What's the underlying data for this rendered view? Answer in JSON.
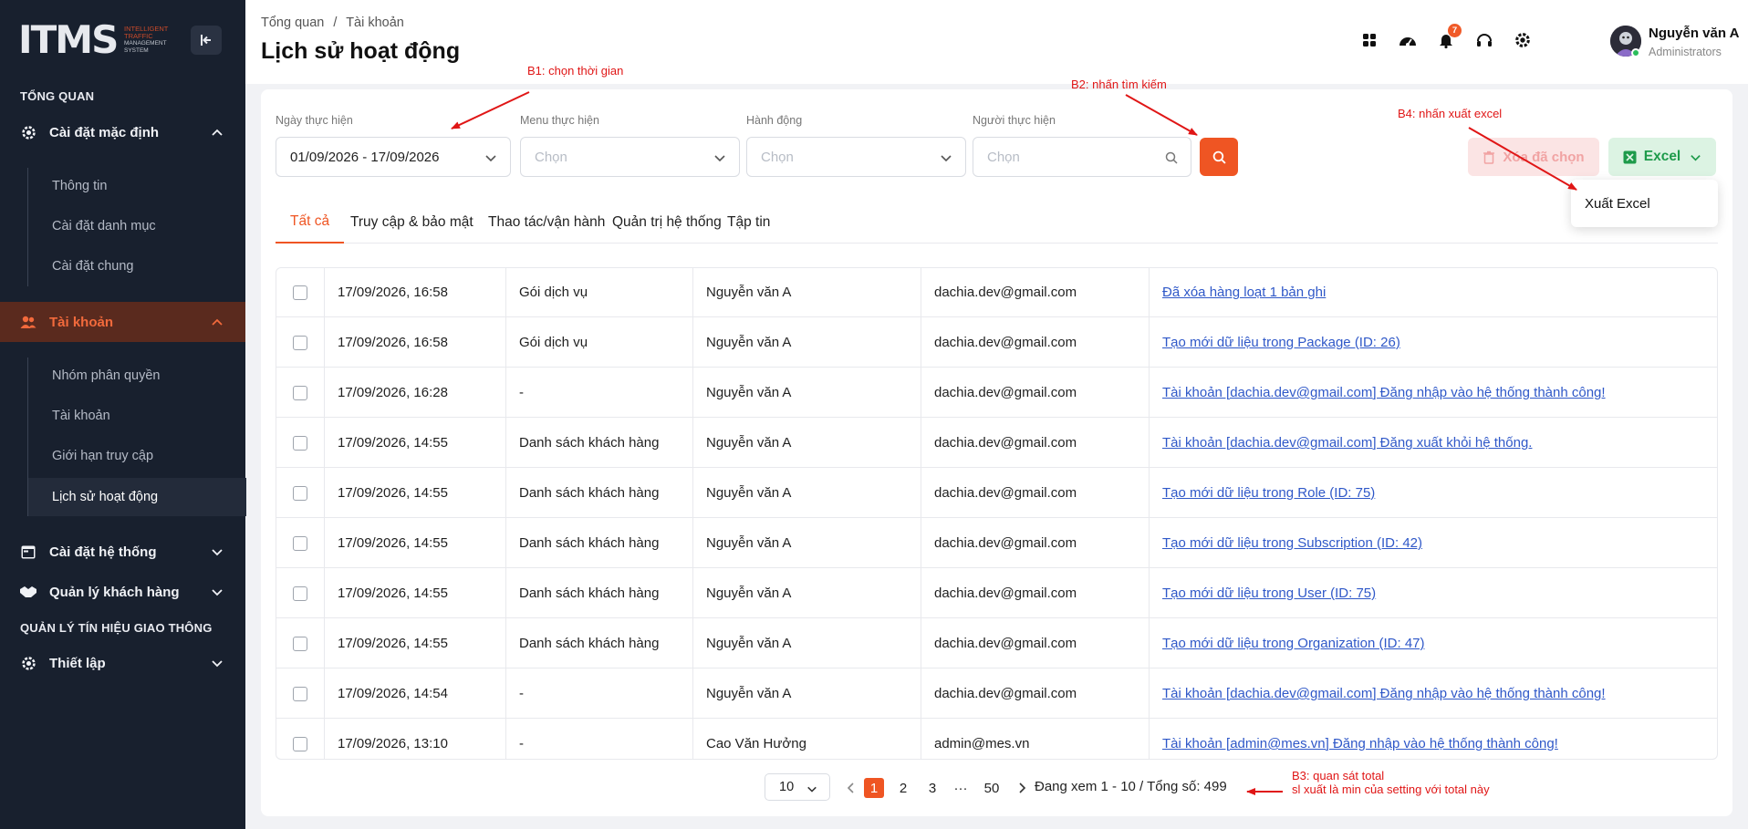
{
  "sidebar": {
    "logo": "ITMS",
    "logo_sub": [
      "INTELLIGENT",
      "TRAFFIC",
      "MANAGEMENT",
      "SYSTEM"
    ],
    "section_overview": "TỔNG QUAN",
    "default_settings": "Cài đặt mặc định",
    "default_sub": [
      "Thông tin",
      "Cài đặt danh mục",
      "Cài đặt chung"
    ],
    "account": "Tài khoản",
    "account_sub": [
      "Nhóm phân quyền",
      "Tài khoản",
      "Giới hạn truy cập",
      "Lịch sử hoạt động"
    ],
    "system_settings": "Cài đặt hệ thống",
    "customer_mgmt": "Quản lý khách hàng",
    "section_traffic": "QUẢN LÝ TÍN HIỆU GIAO THÔNG",
    "setup": "Thiết lập"
  },
  "header": {
    "breadcrumb": [
      "Tổng quan",
      "/",
      "Tài khoản"
    ],
    "title": "Lịch sử hoạt động",
    "notification_count": "7",
    "user_name": "Nguyễn văn A",
    "user_role": "Administrators"
  },
  "filters": {
    "date_label": "Ngày thực hiện",
    "date_value": "01/09/2026 - 17/09/2026",
    "menu_label": "Menu thực hiện",
    "menu_placeholder": "Chọn",
    "action_label": "Hành động",
    "action_placeholder": "Chọn",
    "actor_label": "Người thực hiện",
    "actor_placeholder": "Chọn"
  },
  "buttons": {
    "delete_selected": "Xóa đã chọn",
    "excel": "Excel",
    "export_excel": "Xuất Excel"
  },
  "tabs": [
    "Tất cả",
    "Truy cập & bảo mật",
    "Thao tác/vận hành",
    "Quản trị hệ thống",
    "Tập tin"
  ],
  "rows": [
    {
      "time": "17/09/2026, 16:58",
      "menu": "Gói dịch vụ",
      "user": "Nguyễn văn A",
      "email": "dachia.dev@gmail.com",
      "action": "Đã xóa hàng loạt 1 bản ghi"
    },
    {
      "time": "17/09/2026, 16:58",
      "menu": "Gói dịch vụ",
      "user": "Nguyễn văn A",
      "email": "dachia.dev@gmail.com",
      "action": "Tạo mới dữ liệu trong Package (ID: 26)"
    },
    {
      "time": "17/09/2026, 16:28",
      "menu": "-",
      "user": "Nguyễn văn A",
      "email": "dachia.dev@gmail.com",
      "action": "Tài khoản [dachia.dev@gmail.com] Đăng nhập vào hệ thống thành công!"
    },
    {
      "time": "17/09/2026, 14:55",
      "menu": "Danh sách khách hàng",
      "user": "Nguyễn văn A",
      "email": "dachia.dev@gmail.com",
      "action": "Tài khoản [dachia.dev@gmail.com] Đăng xuất khỏi hệ thống."
    },
    {
      "time": "17/09/2026, 14:55",
      "menu": "Danh sách khách hàng",
      "user": "Nguyễn văn A",
      "email": "dachia.dev@gmail.com",
      "action": "Tạo mới dữ liệu trong Role (ID: 75)"
    },
    {
      "time": "17/09/2026, 14:55",
      "menu": "Danh sách khách hàng",
      "user": "Nguyễn văn A",
      "email": "dachia.dev@gmail.com",
      "action": "Tạo mới dữ liệu trong Subscription (ID: 42)"
    },
    {
      "time": "17/09/2026, 14:55",
      "menu": "Danh sách khách hàng",
      "user": "Nguyễn văn A",
      "email": "dachia.dev@gmail.com",
      "action": "Tạo mới dữ liệu trong User (ID: 75)"
    },
    {
      "time": "17/09/2026, 14:55",
      "menu": "Danh sách khách hàng",
      "user": "Nguyễn văn A",
      "email": "dachia.dev@gmail.com",
      "action": "Tạo mới dữ liệu trong Organization (ID: 47)"
    },
    {
      "time": "17/09/2026, 14:54",
      "menu": "-",
      "user": "Nguyễn văn A",
      "email": "dachia.dev@gmail.com",
      "action": "Tài khoản [dachia.dev@gmail.com] Đăng nhập vào hệ thống thành công!"
    },
    {
      "time": "17/09/2026, 13:10",
      "menu": "-",
      "user": "Cao Văn Hưởng",
      "email": "admin@mes.vn",
      "action": "Tài khoản [admin@mes.vn] Đăng nhập vào hệ thống thành công!"
    }
  ],
  "pagination": {
    "page_size": "10",
    "pages": [
      "1",
      "2",
      "3",
      "···",
      "50"
    ],
    "current": "1",
    "summary": "Đang xem 1 - 10 / Tổng số: 499"
  },
  "annotations": {
    "b1": "B1: chọn thời gian",
    "b2": "B2: nhấn tìm kiếm",
    "b3_line1": "B3: quan sát total",
    "b3_line2": "sl xuất là min của setting với total này",
    "b4": "B4: nhấn xuất excel"
  },
  "colors": {
    "accent": "#ef5523",
    "sidebar_bg": "#18202e",
    "link": "#2f58c8",
    "annotation": "#e01616"
  }
}
